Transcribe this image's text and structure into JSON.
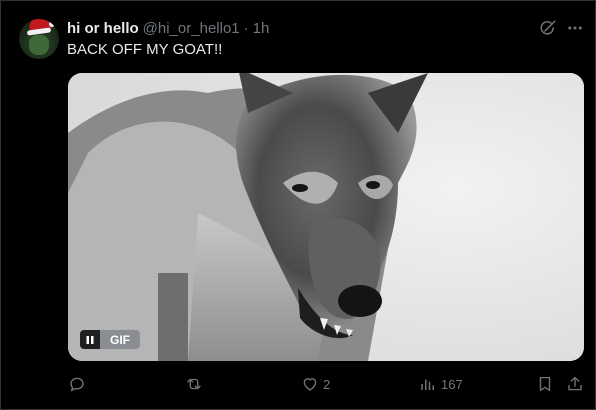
{
  "post": {
    "author_name": "hi or hello",
    "author_handle": "@hi_or_hello1",
    "separator": "·",
    "time_ago": "1h",
    "text": "BACK OFF MY GOAT!!",
    "gif_label": "GIF"
  },
  "actions": {
    "replies": "",
    "reposts": "",
    "likes": "2",
    "views": "167"
  },
  "icons": {
    "grok": "grok-icon",
    "more": "more-icon",
    "reply": "reply-icon",
    "repost": "repost-icon",
    "like": "heart-icon",
    "views": "views-icon",
    "bookmark": "bookmark-icon",
    "share": "share-icon"
  },
  "colors": {
    "background": "#000000",
    "text_primary": "#e7e9ea",
    "text_secondary": "#71767b",
    "border": "#2f3336"
  }
}
